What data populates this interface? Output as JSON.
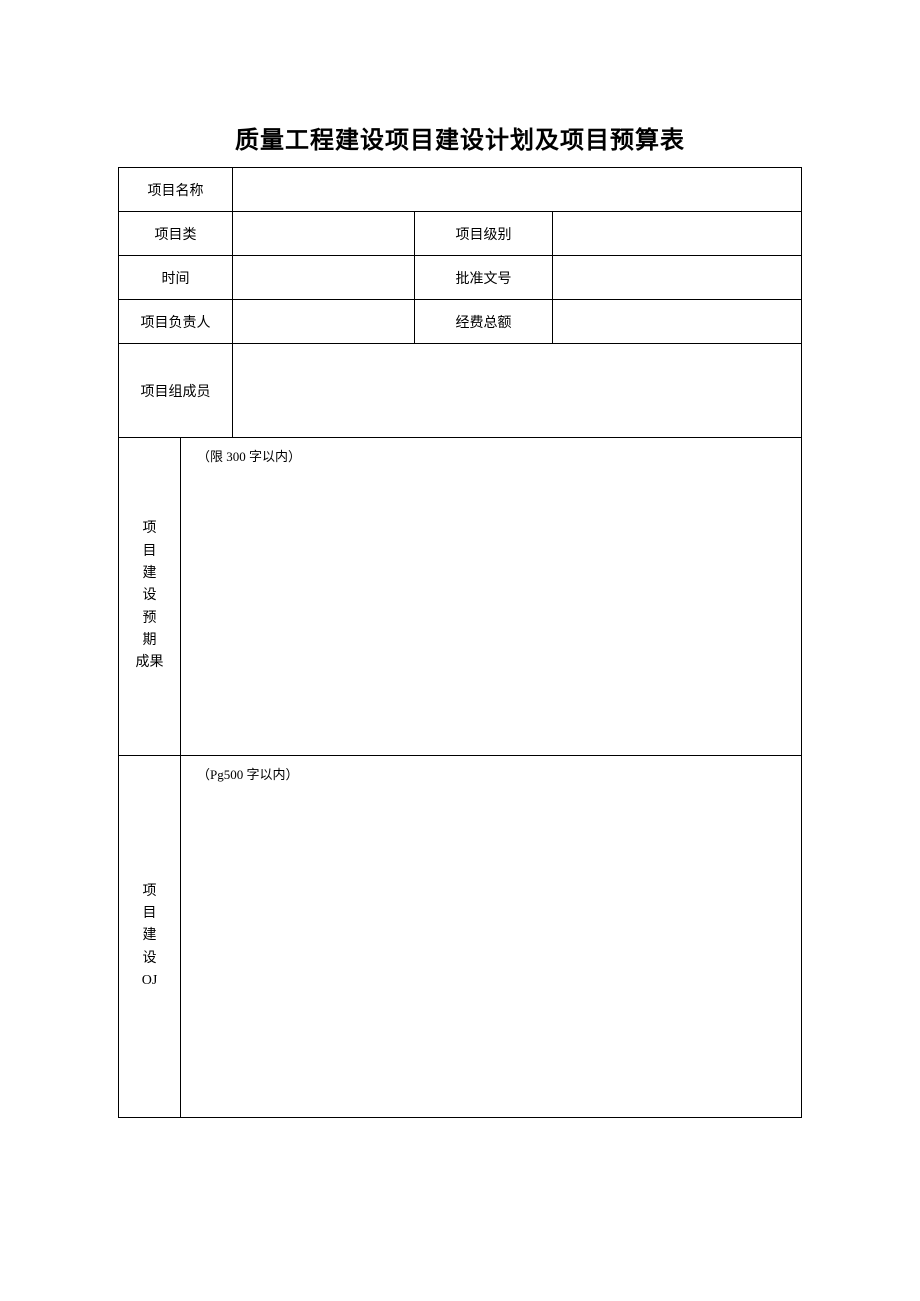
{
  "title": "质量工程建设项目建设计划及项目预算表",
  "rows": {
    "r1c1": "项目名称",
    "r2c1": "项目类",
    "r2c3": "项目级别",
    "r3c1": "时间",
    "r3c3": "批准文号",
    "r4c1": "项目负责人",
    "r4c3": "经费总额",
    "r5c1": "项目组成员"
  },
  "section1": {
    "label_l1": "项　目",
    "label_l2": "建　设",
    "label_l3": "预　期",
    "label_l4": "成果",
    "note": "（限 300 字以内）"
  },
  "section2": {
    "label_l1": "项　目",
    "label_l2": "建　设",
    "label_l3": "OJ",
    "note": "（Pg500 字以内）"
  }
}
